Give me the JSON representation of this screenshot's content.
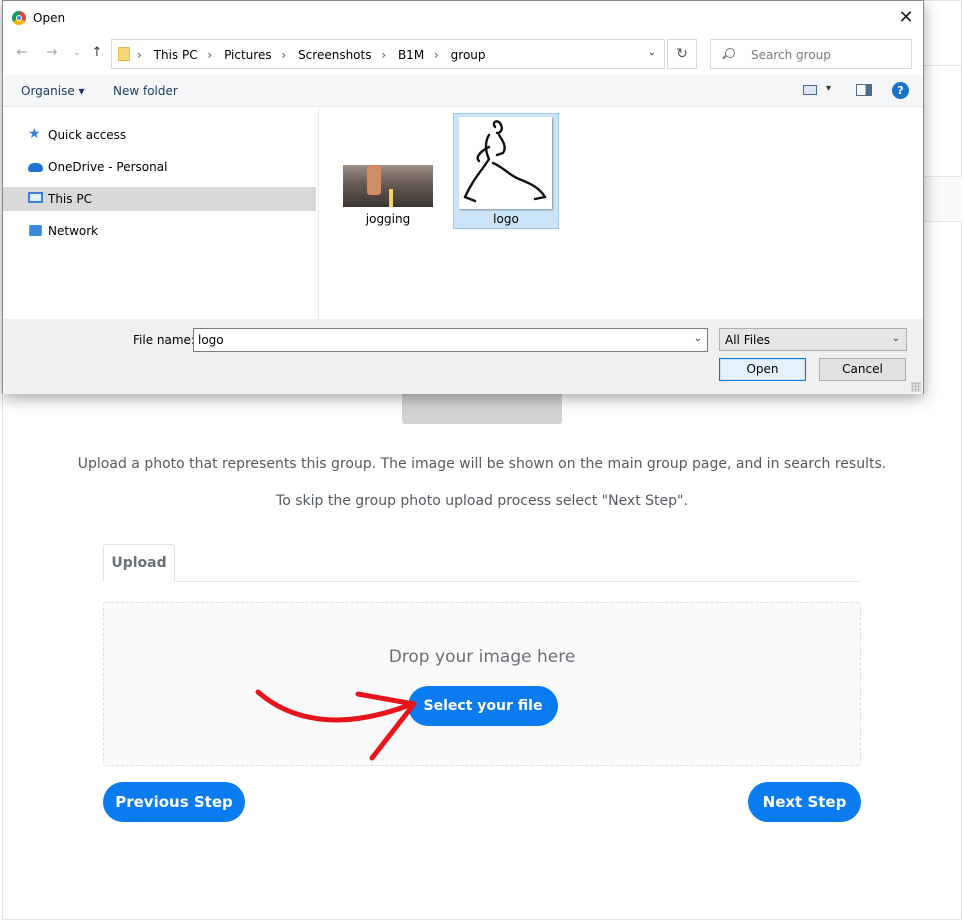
{
  "dialog": {
    "title": "Open",
    "close_glyph": "✕",
    "nav": {
      "back_glyph": "←",
      "forward_glyph": "→",
      "recent_glyph": "⌄",
      "up_glyph": "↑",
      "breadcrumbs": [
        "This PC",
        "Pictures",
        "Screenshots",
        "B1M",
        "group"
      ],
      "breadcrumb_separator": "›",
      "refresh_glyph": "↻",
      "search_placeholder": "Search group"
    },
    "toolbar": {
      "organise_label": "Organise ▾",
      "new_folder_label": "New folder",
      "view_dropdown_glyph": "▾",
      "help_glyph": "?"
    },
    "sidebar": {
      "items": [
        {
          "label": "Quick access",
          "icon": "star-icon"
        },
        {
          "label": "OneDrive - Personal",
          "icon": "cloud-icon"
        },
        {
          "label": "This PC",
          "icon": "computer-icon",
          "selected": true
        },
        {
          "label": "Network",
          "icon": "network-icon"
        }
      ]
    },
    "files": [
      {
        "name": "jogging",
        "selected": false
      },
      {
        "name": "logo",
        "selected": true
      }
    ],
    "footer": {
      "file_name_label": "File name:",
      "file_name_value": "logo",
      "filter_value": "All Files",
      "dropdown_glyph": "⌄",
      "open_label": "Open",
      "cancel_label": "Cancel"
    }
  },
  "page": {
    "description_1": "Upload a photo that represents this group. The image will be shown on the main group page, and in search results.",
    "description_2": "To skip the group photo upload process select \"Next Step\".",
    "tab_upload": "Upload",
    "drop_text": "Drop your image here",
    "select_file_label": "Select your file",
    "previous_step_label": "Previous Step",
    "next_step_label": "Next Step",
    "accent_color": "#0a7cf0",
    "annotation_arrow_color": "#e8141c"
  }
}
